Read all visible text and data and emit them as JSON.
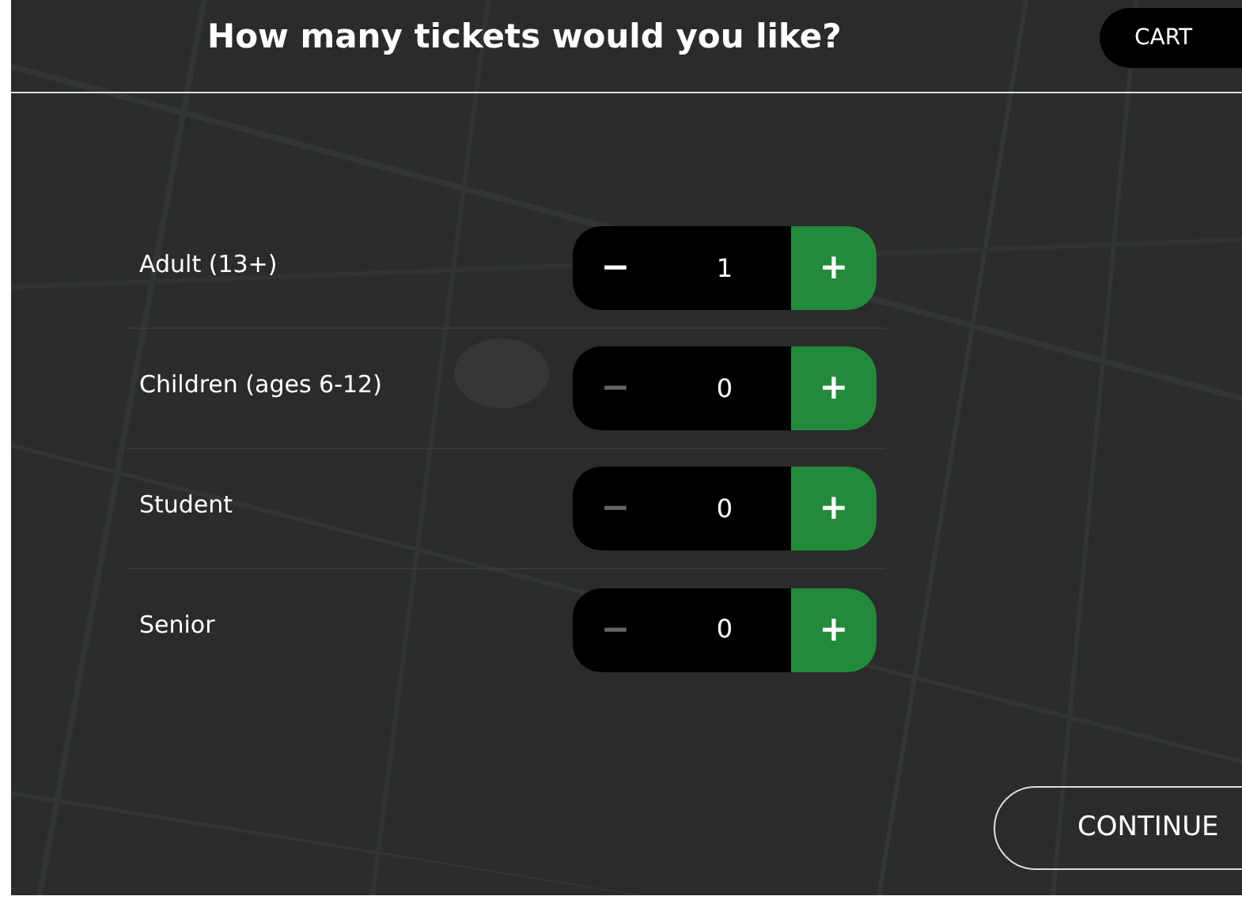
{
  "header": {
    "title": "How many tickets would you like?",
    "cart_button": "CART"
  },
  "ticket_types": [
    {
      "label": "Adult (13+)",
      "minus": "−",
      "count": "1",
      "plus": "+",
      "minus_disabled": false
    },
    {
      "label": "Children (ages 6-12)",
      "minus": "−",
      "count": "0",
      "plus": "+",
      "minus_disabled": true
    },
    {
      "label": "Student",
      "minus": "−",
      "count": "0",
      "plus": "+",
      "minus_disabled": true
    },
    {
      "label": "Senior",
      "minus": "−",
      "count": "0",
      "plus": "+",
      "minus_disabled": true
    }
  ],
  "continue_button": "CONTINUE"
}
